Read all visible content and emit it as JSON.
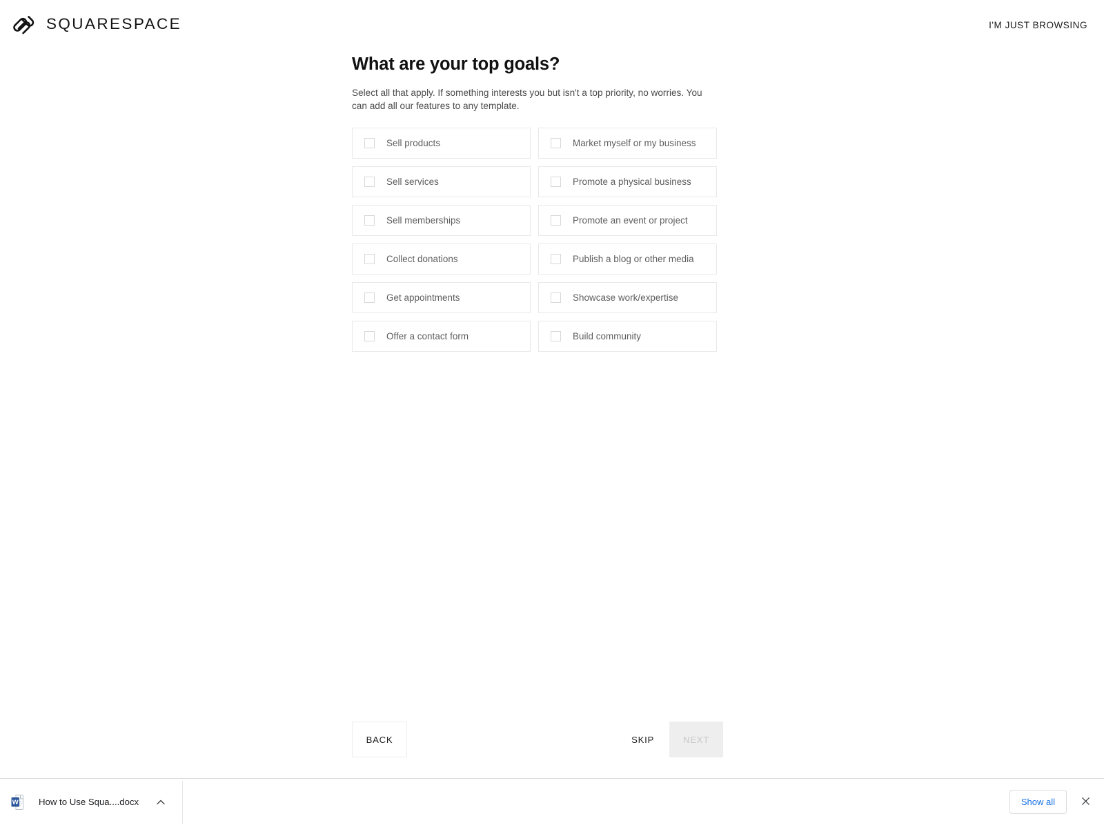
{
  "header": {
    "brand_name": "SQUARESPACE",
    "brand_icon": "squarespace-logo-icon",
    "browsing_label": "I'M JUST BROWSING"
  },
  "main": {
    "title": "What are your top goals?",
    "subtitle": "Select all that apply. If something interests you but isn't a top priority, no worries. You can add all our features to any template.",
    "goals": [
      {
        "label": "Sell products",
        "checked": false
      },
      {
        "label": "Market myself or my business",
        "checked": false
      },
      {
        "label": "Sell services",
        "checked": false
      },
      {
        "label": "Promote a physical business",
        "checked": false
      },
      {
        "label": "Sell memberships",
        "checked": false
      },
      {
        "label": "Promote an event or project",
        "checked": false
      },
      {
        "label": "Collect donations",
        "checked": false
      },
      {
        "label": "Publish a blog or other media",
        "checked": false
      },
      {
        "label": "Get appointments",
        "checked": false
      },
      {
        "label": "Showcase work/expertise",
        "checked": false
      },
      {
        "label": "Offer a contact form",
        "checked": false
      },
      {
        "label": "Build community",
        "checked": false
      }
    ]
  },
  "actions": {
    "back_label": "BACK",
    "skip_label": "SKIP",
    "next_label": "NEXT",
    "next_disabled": true
  },
  "download_shelf": {
    "file_name": "How to Use Squa....docx",
    "file_icon": "word-document-icon",
    "menu_icon": "chevron-up-icon",
    "show_all_label": "Show all",
    "close_icon": "close-icon",
    "accent_color": "#1a73e8"
  }
}
